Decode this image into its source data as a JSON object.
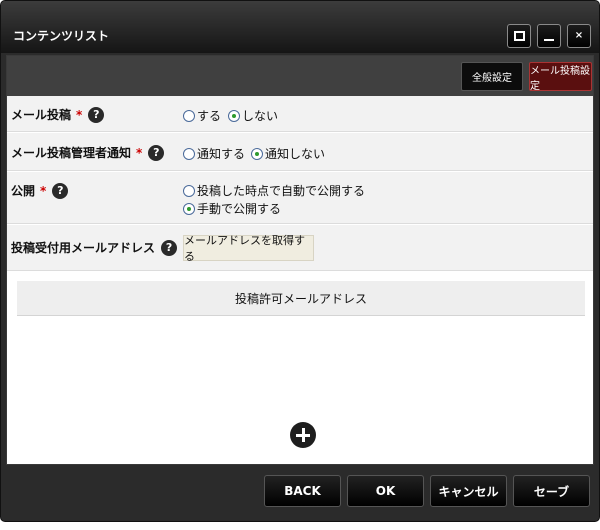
{
  "window": {
    "title": "コンテンツリスト",
    "close_glyph": "×"
  },
  "toolbar": {
    "all_settings_label": "全般設定",
    "mail_post_settings_label": "メール投稿設定"
  },
  "form": {
    "mail_posting": {
      "label": "メール投稿",
      "required_mark": "*",
      "options": [
        "する",
        "しない"
      ],
      "selected": "しない"
    },
    "admin_notification": {
      "label": "メール投稿管理者通知",
      "required_mark": "*",
      "options": [
        "通知する",
        "通知しない"
      ],
      "selected": "通知しない"
    },
    "publish": {
      "label": "公開",
      "required_mark": "*",
      "options": [
        "投稿した時点で自動で公開する",
        "手動で公開する"
      ],
      "selected": "手動で公開する"
    },
    "receive_address": {
      "label": "投稿受付用メールアドレス",
      "button_label": "メールアドレスを取得する"
    }
  },
  "allowed_addresses": {
    "column_header": "投稿許可メールアドレス"
  },
  "footer": {
    "back_label": "BACK",
    "ok_label": "OK",
    "cancel_label": "キャンセル",
    "save_label": "セーブ"
  },
  "icons": {
    "help": "help-icon",
    "add": "plus-circle-icon"
  },
  "colors": {
    "accent_active_tab": "#5a0f0f",
    "required": "#cc0000",
    "radio_checked": "#2e9a2e"
  }
}
